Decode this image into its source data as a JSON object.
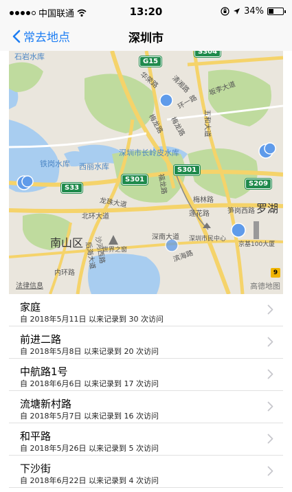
{
  "status": {
    "carrier": "中国联通",
    "time": "13:20",
    "battery_text": "34%",
    "battery_level": 0.34,
    "signal_bars": 4
  },
  "nav": {
    "back_label": "常去地点",
    "title": "深圳市"
  },
  "map": {
    "labels": {
      "shiyan_reservoir": "石岩水库",
      "huarong_rd": "华荣路",
      "qingxiang_rd": "清湘路",
      "ring_road": "环一路",
      "bantian_ave": "坂李大道",
      "meilong_rd": "梅龙路",
      "longhua_rd": "梅龙路",
      "wuhe_ave": "五和大道",
      "changling_reservoir": "深圳市长岭皮水库",
      "tiegang_reservoir": "铁岗水库",
      "xili_reservoir": "西丽水库",
      "longzhu_ave": "龙珠大道",
      "fulong_rd": "福龙路",
      "meilin_rd": "梅林路",
      "beihuan_ave": "北环大道",
      "lianhua_rd": "莲花路",
      "bugang_w_rd": "笋岗西路",
      "luohu": "罗湖",
      "nanshan": "南山区",
      "shenan_ave": "深南大道",
      "civic_center": "深圳市民中心",
      "kk100": "京基100大厦",
      "window_world": "世界之窗",
      "binhai_rd": "滨海路",
      "neihuan_rd": "内环路",
      "houhai_ave": "后海大道",
      "shahe_rd": "沙河西路"
    },
    "shields": {
      "g15": "G15",
      "s301a": "S301",
      "s301b": "S301",
      "s33": "S33",
      "s209": "S209",
      "s304": "S304"
    },
    "badge": "9",
    "legal": "法律信息",
    "logo": "高德地图"
  },
  "places": [
    {
      "name": "家庭",
      "detail": "自 2018年5月11日 以来记录到 30 次访问"
    },
    {
      "name": "前进二路",
      "detail": "自 2018年5月8日 以来记录到 20 次访问"
    },
    {
      "name": "中航路1号",
      "detail": "自 2018年6月6日 以来记录到 17 次访问"
    },
    {
      "name": "流塘新村路",
      "detail": "自 2018年5月7日 以来记录到 16 次访问"
    },
    {
      "name": "和平路",
      "detail": "自 2018年5月26日 以来记录到 5 次访问"
    },
    {
      "name": "下沙街",
      "detail": "自 2018年6月22日 以来记录到 4 次访问"
    }
  ],
  "colors": {
    "accent": "#1e7ef3",
    "marker": "#5f9bea",
    "park": "#bfdb9e",
    "water": "#a8cdf0",
    "highway": "#f5d36a",
    "shield": "#1f8a4c"
  }
}
